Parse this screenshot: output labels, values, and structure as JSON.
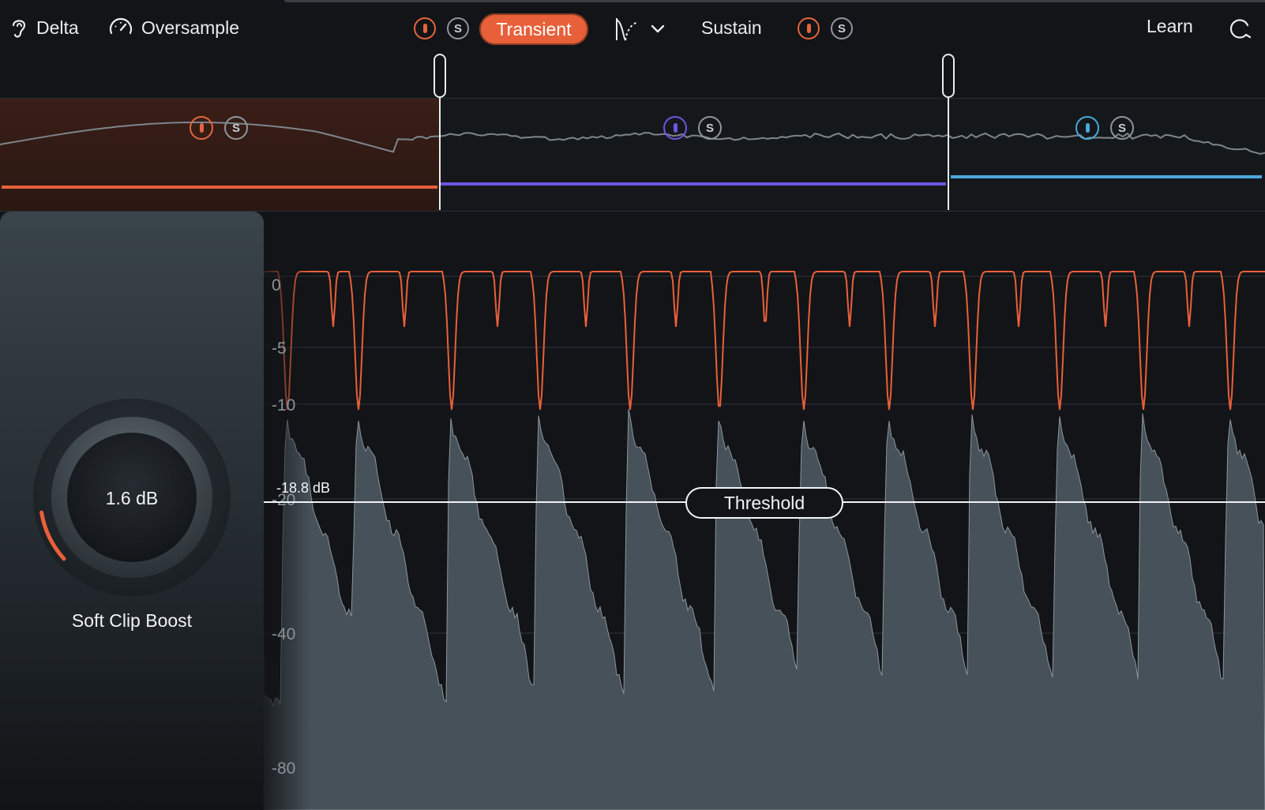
{
  "toolbar": {
    "delta_label": "Delta",
    "oversample_label": "Oversample",
    "transient_label": "Transient",
    "sustain_label": "Sustain",
    "learn_label": "Learn",
    "solo_glyph": "S",
    "icons": [
      "ear-icon",
      "speedometer-icon",
      "curve-icon",
      "chevron-down-icon",
      "reset-icon"
    ]
  },
  "bands": [
    {
      "color": "#e8603a",
      "solo": "S"
    },
    {
      "color": "#6e54e6",
      "solo": "S"
    },
    {
      "color": "#4aa8dd",
      "solo": "S"
    }
  ],
  "knob": {
    "value": "1.6 dB",
    "label": "Soft Clip Boost"
  },
  "graph": {
    "db_labels": [
      "0",
      "-5",
      "-10",
      "-20",
      "-40",
      "-80"
    ],
    "threshold_value": "-18.8 dB",
    "threshold_label": "Threshold"
  },
  "colors": {
    "accent": "#e8603a",
    "background": "#121417",
    "waveform": "#465159"
  }
}
